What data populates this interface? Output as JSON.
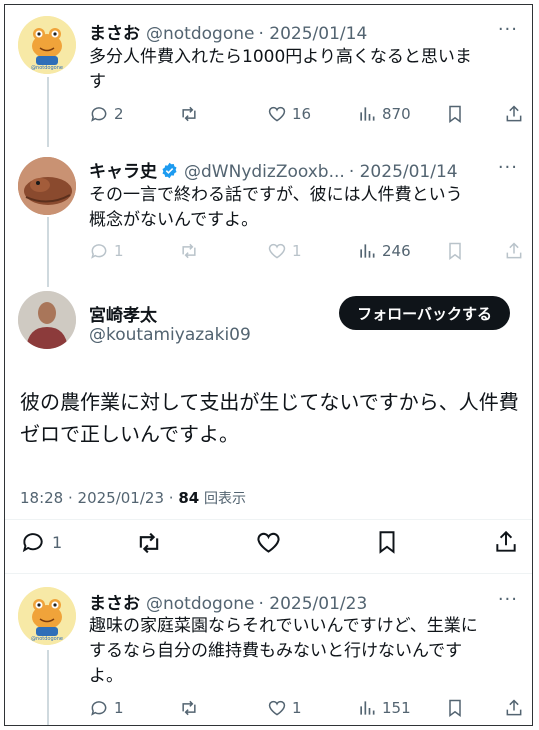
{
  "tweets": [
    {
      "name": "まさお",
      "handle": "@notdogone",
      "date": "· 2025/01/14",
      "text_line1": "多分人件費入れたら1000円より高くなると思いま",
      "text_line2": "す",
      "replies": "2",
      "retweets": "",
      "likes": "16",
      "views": "870"
    },
    {
      "name": "キャラ史",
      "handle": "@dWNydizZooxb...",
      "date": "· 2025/01/14",
      "text_line1": "その一言で終わる話ですが、彼には人件費という",
      "text_line2": "概念がないんですよ。",
      "replies": "1",
      "retweets": "",
      "likes": "1",
      "views": "246"
    }
  ],
  "main": {
    "name": "宮崎孝太",
    "handle": "@koutamiyazaki09",
    "follow_label": "フォローバックする",
    "text": "彼の農作業に対して支出が生じてないですから、人件費ゼロで正しいんですよ。",
    "time": "18:28 · 2025/01/23 ·",
    "views_count": "84",
    "views_label": "回表示",
    "replies": "1"
  },
  "reply": {
    "name": "まさお",
    "handle": "@notdogone",
    "date": "· 2025/01/23",
    "text_line1": "趣味の家庭菜園ならそれでいいんですけど、生業に",
    "text_line2": "するなら自分の維持費もみないと行けないんです",
    "text_line3": "よ。",
    "replies": "1",
    "retweets": "",
    "likes": "1",
    "views": "151"
  },
  "more_glyph": "···",
  "colors": {
    "verified": "#1d9bf0",
    "follow_bg": "#0f1419",
    "muted": "#536471"
  }
}
